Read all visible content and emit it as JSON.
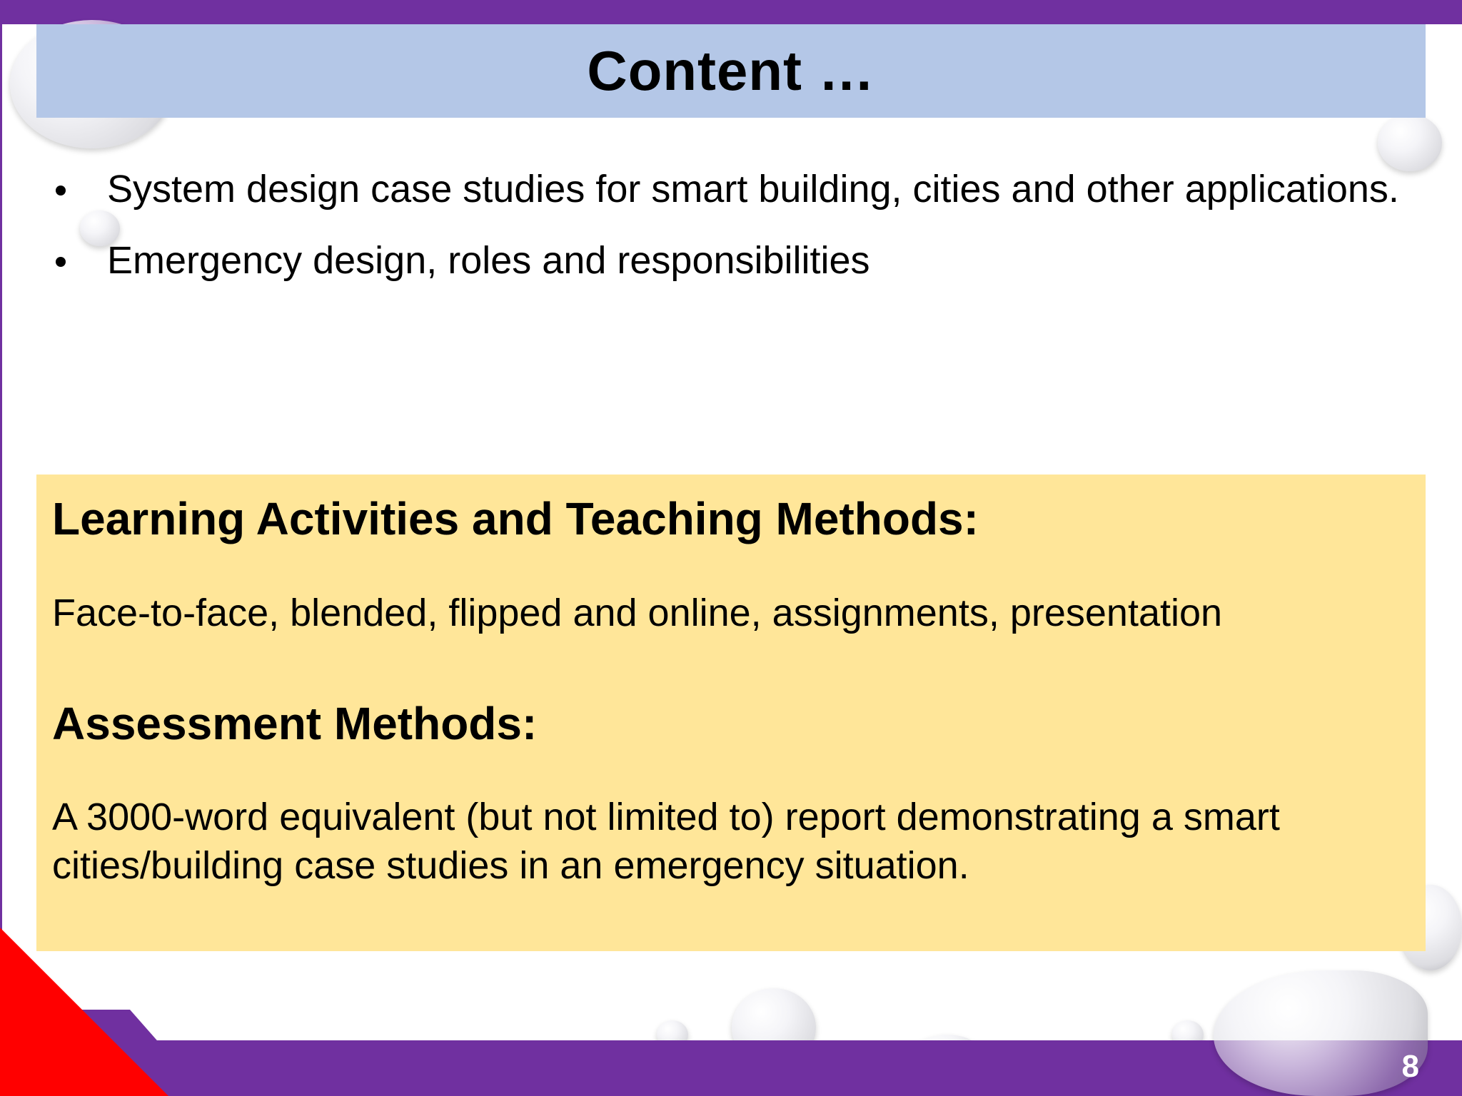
{
  "slide": {
    "title": "Content …",
    "bullets": [
      "System design case studies for smart building, cities and other applications.",
      "Emergency design, roles and responsibilities"
    ],
    "learning_heading": "Learning Activities and Teaching Methods:",
    "learning_text": "Face-to-face, blended, flipped and online, assignments, presentation",
    "assessment_heading": "Assessment Methods:",
    "assessment_text": "A 3000-word equivalent (but not limited to) report demonstrating a smart cities/building case studies in an emergency situation.",
    "page_number": "8"
  },
  "colors": {
    "frame_purple": "#7030a0",
    "title_band": "#b4c7e7",
    "info_box": "#ffe699",
    "corner_red": "#ff0000"
  }
}
